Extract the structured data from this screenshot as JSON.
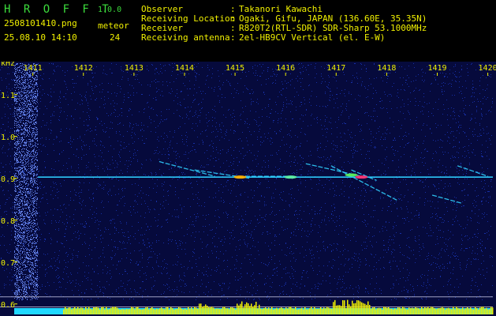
{
  "app": {
    "logo": "H R O F F T",
    "version": "1.0.0",
    "filename": "2508101410.png",
    "meteor_label": "meteor",
    "timestamp": "25.08.10 14:10",
    "meteor_count": "24"
  },
  "info": {
    "rows": [
      {
        "label": "Observer",
        "sep": ":",
        "value": "Takanori Kawachi"
      },
      {
        "label": "Receiving Location",
        "sep": ":",
        "value": "Ogaki, Gifu, JAPAN (136.60E, 35.35N)"
      },
      {
        "label": "Receiver",
        "sep": ":",
        "value": "R820T2(RTL-SDR) SDR-Sharp 53.1000MHz"
      },
      {
        "label": "Receiving antenna",
        "sep": ":",
        "value": "2el-HB9CV Vertical (el. E-W)"
      }
    ]
  },
  "chart_data": {
    "type": "heatmap",
    "xlabel": "",
    "ylabel": "kHz",
    "x_ticks": [
      "1411",
      "1412",
      "1413",
      "1414",
      "1415",
      "1416",
      "1417",
      "1418",
      "1419",
      "1420"
    ],
    "y_ticks": [
      "1.1",
      "1.0",
      "0.9",
      "0.8",
      "0.7",
      "0.6"
    ],
    "xlim": [
      1410.35,
      1420.1
    ],
    "ylim": [
      0.575,
      1.175
    ],
    "carrier_khz": 0.903,
    "carrier_start_s": 1411.1,
    "meteor_streaks": [
      {
        "x1": 1413.5,
        "y1": 0.94,
        "x2": 1414.6,
        "y2": 0.905
      },
      {
        "x1": 1414.2,
        "y1": 0.92,
        "x2": 1415.3,
        "y2": 0.9
      },
      {
        "x1": 1415.2,
        "y1": 0.905,
        "x2": 1416.2,
        "y2": 0.905
      },
      {
        "x1": 1416.4,
        "y1": 0.935,
        "x2": 1417.5,
        "y2": 0.905
      },
      {
        "x1": 1416.9,
        "y1": 0.93,
        "x2": 1418.2,
        "y2": 0.848
      },
      {
        "x1": 1417.3,
        "y1": 0.92,
        "x2": 1417.8,
        "y2": 0.895
      },
      {
        "x1": 1418.9,
        "y1": 0.86,
        "x2": 1419.5,
        "y2": 0.84
      },
      {
        "x1": 1419.4,
        "y1": 0.93,
        "x2": 1420.0,
        "y2": 0.905
      }
    ],
    "hot_spots": [
      {
        "x": 1417.3,
        "y": 0.908,
        "color": "#5cf05c"
      },
      {
        "x": 1417.5,
        "y": 0.903,
        "color": "#ff3070"
      },
      {
        "x": 1415.1,
        "y": 0.903,
        "color": "#ffb000"
      },
      {
        "x": 1416.1,
        "y": 0.903,
        "color": "#60f0a0"
      }
    ],
    "colors": {
      "background": "#060a3c",
      "noise": "#1e3cc8",
      "axis_text": "#f0f000",
      "carrier": "#30d0ff",
      "bottom_band": "#20d8ff",
      "bottom_peaks": "#f0f000",
      "ref_line": "#c8c8e8"
    },
    "ref_lines_khz": [
      0.617,
      0.593
    ]
  }
}
